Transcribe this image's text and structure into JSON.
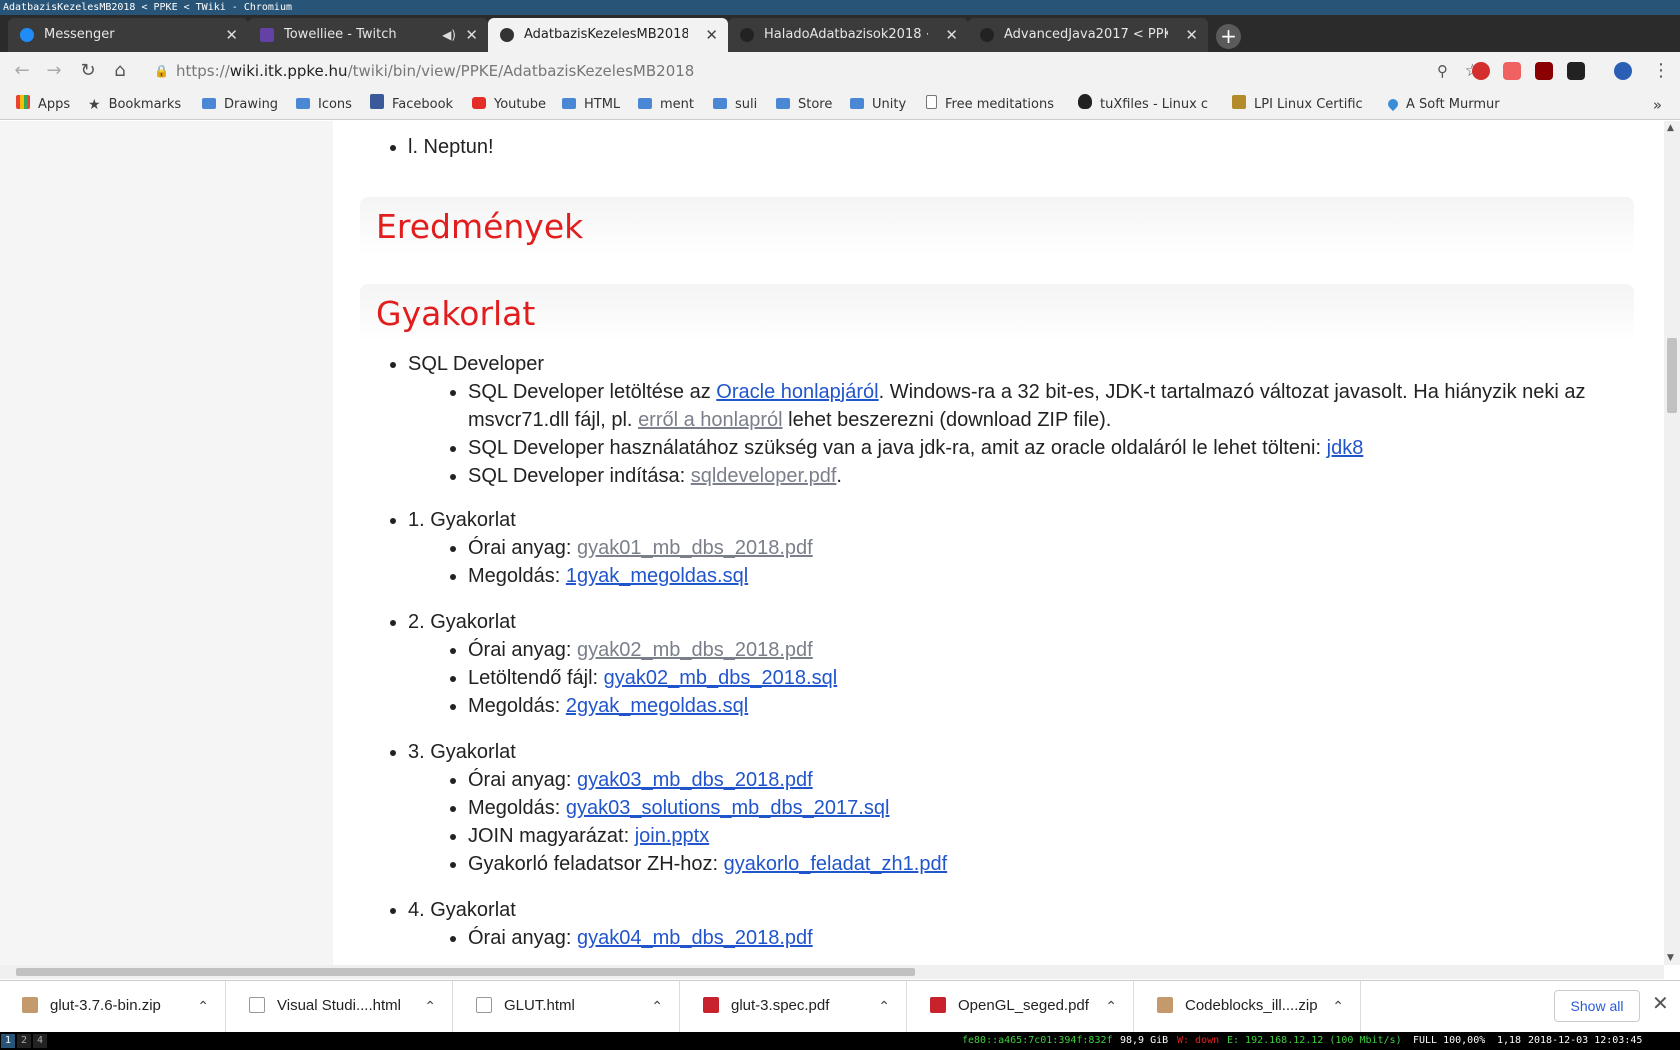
{
  "window": {
    "title": "AdatbazisKezelesMB2018 < PPKE < TWiki - Chromium"
  },
  "tabs": [
    {
      "title": "Messenger",
      "icon": "messenger-icon",
      "active": false
    },
    {
      "title": "Towelliee - Twitch",
      "icon": "twitch-icon",
      "active": false,
      "audio": true
    },
    {
      "title": "AdatbazisKezelesMB2018 <",
      "icon": "twiki-icon",
      "active": true
    },
    {
      "title": "HaladoAdatbazisok2018 <",
      "icon": "twiki-icon",
      "active": false
    },
    {
      "title": "AdvancedJava2017 < PPKE",
      "icon": "twiki-icon",
      "active": false
    }
  ],
  "url": {
    "scheme": "https://",
    "host": "wiki.itk.ppke.hu",
    "path": "/twiki/bin/view/PPKE/AdatbazisKezelesMB2018"
  },
  "bookmarks": [
    {
      "label": "Apps",
      "icon": "apps"
    },
    {
      "label": "Bookmarks",
      "icon": "star"
    },
    {
      "label": "Drawing",
      "icon": "folder"
    },
    {
      "label": "Icons",
      "icon": "folder"
    },
    {
      "label": "Facebook",
      "icon": "fb"
    },
    {
      "label": "Youtube",
      "icon": "yt"
    },
    {
      "label": "HTML",
      "icon": "folder"
    },
    {
      "label": "ment",
      "icon": "folder"
    },
    {
      "label": "suli",
      "icon": "folder"
    },
    {
      "label": "Store",
      "icon": "folder"
    },
    {
      "label": "Unity",
      "icon": "folder"
    },
    {
      "label": "Free meditations",
      "icon": "page"
    },
    {
      "label": "tuXfiles - Linux c",
      "icon": "tux"
    },
    {
      "label": "LPI Linux Certific",
      "icon": "lpi"
    },
    {
      "label": "A Soft Murmur",
      "icon": "drop"
    }
  ],
  "content": {
    "neptun_item": "l. Neptun!",
    "h_eredmenyek": "Eredmények",
    "h_gyakorlat": "Gyakorlat",
    "sqldev": {
      "title": "SQL Developer",
      "l1_pre": "SQL Developer letöltése az ",
      "l1_link": "Oracle honlapjáról",
      "l1_post": ". Windows-ra a 32 bit-es, JDK-t tartalmazó változat javasolt. Ha hiányzik neki az msvcr71.dll fájl, pl. ",
      "l1_link2": "erről a honlapról",
      "l1_post2": " lehet beszerezni (download ZIP file).",
      "l2_pre": "SQL Developer használatához szükség van a java jdk-ra, amit az oracle oldaláról le lehet tölteni: ",
      "l2_link": "jdk8",
      "l3_pre": "SQL Developer indítása: ",
      "l3_link": "sqldeveloper.pdf",
      "l3_post": "."
    },
    "g1": {
      "title": "1. Gyakorlat",
      "a_label": "Órai anyag: ",
      "a_link": "gyak01_mb_dbs_2018.pdf",
      "b_label": "Megoldás: ",
      "b_link": "1gyak_megoldas.sql"
    },
    "g2": {
      "title": "2. Gyakorlat",
      "a_label": "Órai anyag: ",
      "a_link": "gyak02_mb_dbs_2018.pdf",
      "b_label": "Letöltendő fájl: ",
      "b_link": "gyak02_mb_dbs_2018.sql",
      "c_label": "Megoldás: ",
      "c_link": "2gyak_megoldas.sql"
    },
    "g3": {
      "title": "3. Gyakorlat",
      "a_label": "Órai anyag: ",
      "a_link": "gyak03_mb_dbs_2018.pdf",
      "b_label": "Megoldás: ",
      "b_link": "gyak03_solutions_mb_dbs_2017.sql",
      "c_label": "JOIN magyarázat: ",
      "c_link": "join.pptx",
      "d_label": "Gyakorló feladatsor ZH-hoz: ",
      "d_link": "gyakorlo_feladat_zh1.pdf"
    },
    "g4": {
      "title": "4. Gyakorlat",
      "a_label": "Órai anyag: ",
      "a_link": "gyak04_mb_dbs_2018.pdf"
    }
  },
  "downloads": [
    {
      "name": "glut-3.7.6-bin.zip",
      "type": "zip"
    },
    {
      "name": "Visual Studi....html",
      "type": "html"
    },
    {
      "name": "GLUT.html",
      "type": "html"
    },
    {
      "name": "glut-3.spec.pdf",
      "type": "pdf"
    },
    {
      "name": "OpenGL_seged.pdf",
      "type": "pdf"
    },
    {
      "name": "Codeblocks_ill....zip",
      "type": "zip"
    }
  ],
  "downloads_show_all": "Show all",
  "statusbar": {
    "workspaces": [
      "1",
      "2",
      "4"
    ],
    "ipv6": "fe80::a465:7c01:394f:832f",
    "disk": "98,9 GiB",
    "wifi": "W: down",
    "eth": "E: 192.168.12.12 (100 Mbit/s)",
    "battery": "FULL 100,00%",
    "load": "1,18",
    "datetime": "2018-12-03 12:03:45"
  },
  "colors": {
    "accent": "#285577",
    "heading": "#e21d1d",
    "link": "#2155cc",
    "visited": "#7a7f8a"
  }
}
